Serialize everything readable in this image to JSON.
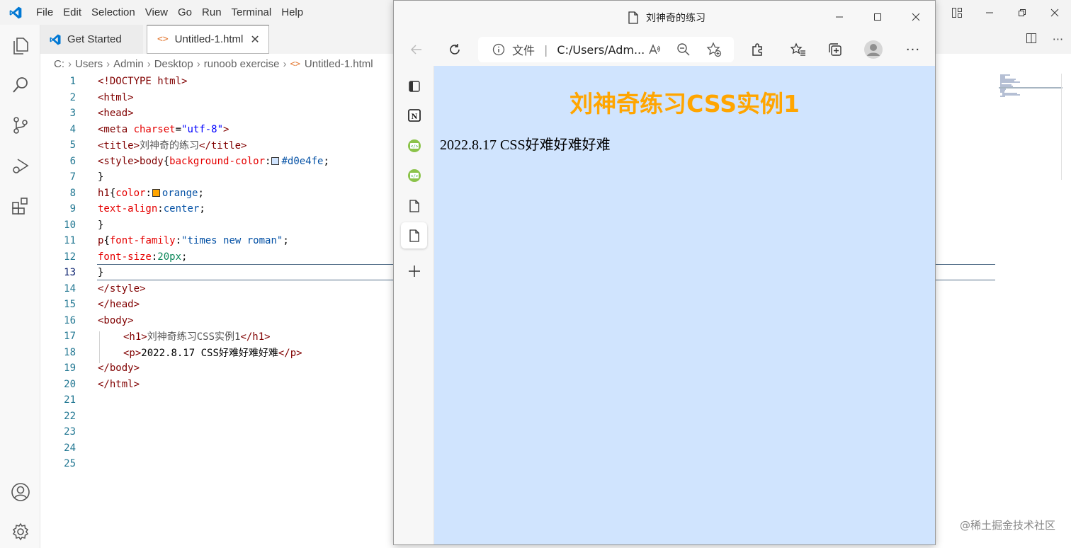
{
  "vscode": {
    "menu": [
      "File",
      "Edit",
      "Selection",
      "View",
      "Go",
      "Run",
      "Terminal",
      "Help"
    ],
    "tabs": [
      {
        "label": "Get Started",
        "icon": "vscode-logo-icon"
      },
      {
        "label": "Untitled-1.html",
        "icon": "html-file-icon",
        "close": "✕"
      }
    ],
    "breadcrumb": [
      "C:",
      "Users",
      "Admin",
      "Desktop",
      "runoob exercise",
      "Untitled-1.html"
    ],
    "line_numbers": [
      "1",
      "2",
      "3",
      "4",
      "5",
      "6",
      "7",
      "8",
      "9",
      "10",
      "11",
      "12",
      "13",
      "14",
      "15",
      "16",
      "17",
      "18",
      "19",
      "20",
      "21",
      "22",
      "23",
      "24",
      "25"
    ],
    "code": {
      "l1": "<!DOCTYPE html>",
      "l2": "<html>",
      "l3": "<head>",
      "l4a": "<meta ",
      "l4b": "charset",
      "l4c": "=",
      "l4d": "\"utf-8\"",
      "l4e": ">",
      "l5a": "<title>",
      "l5b": "刘神奇的练习",
      "l5c": "</title>",
      "l6a": "<style>",
      "l6b": "body",
      "l6c": "{",
      "l6d": "background-color",
      "l6e": ":",
      "l6f": "#d0e4fe",
      "l6g": ";",
      "l7": "}",
      "l8a": "h1",
      "l8b": "{",
      "l8c": "color",
      "l8d": ":",
      "l8e": "orange",
      "l8f": ";",
      "l9a": "text-align",
      "l9b": ":",
      "l9c": "center",
      "l9d": ";",
      "l10": "}",
      "l11a": "p",
      "l11b": "{",
      "l11c": "font-family",
      "l11d": ":",
      "l11e": "\"times new roman\"",
      "l11f": ";",
      "l12a": "font-size",
      "l12b": ":",
      "l12c": "20px",
      "l12d": ";",
      "l13": "}",
      "l14": "</style>",
      "l15": "</head>",
      "l16": "<body>",
      "l17a": "<h1>",
      "l17b": "刘神奇练习CSS实例1",
      "l17c": "</h1>",
      "l18a": "<p>",
      "l18b": "2022.8.17 CSS好难好难好难",
      "l18c": "</p>",
      "l19": "</body>",
      "l20": "</html>"
    },
    "swatch_colors": {
      "bg": "#d0e4fe",
      "h1": "#ffa500"
    },
    "watermark": "@稀土掘金技术社区"
  },
  "browser": {
    "title": "刘神奇的练习",
    "address_label": "文件",
    "address": "C:/Users/Adm...",
    "page": {
      "h1": "刘神奇练习CSS实例1",
      "p": "2022.8.17 CSS好难好难好难",
      "background": "#d0e4fe",
      "h1_color": "#ffa500"
    }
  }
}
